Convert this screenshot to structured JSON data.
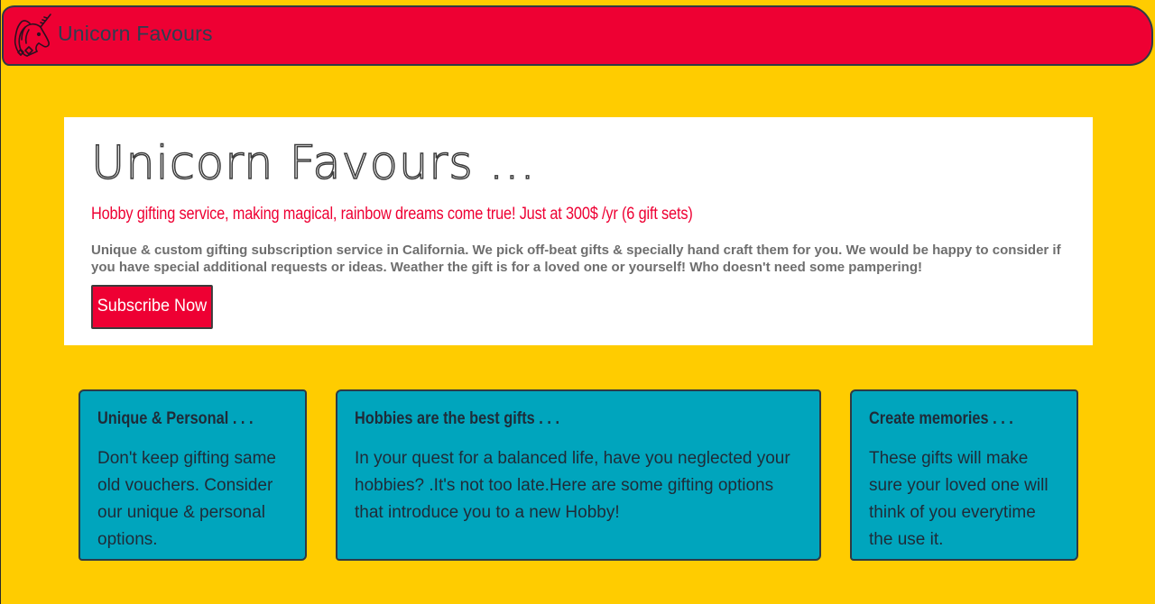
{
  "navbar": {
    "brand_name": "Unicorn Favours",
    "logo_icon": "unicorn-icon"
  },
  "hero": {
    "title": "Unicorn Favours ...",
    "lead": "Hobby gifting service, making magical, rainbow dreams come true! Just at 300$ /yr (6 gift sets)",
    "description": "Unique & custom gifting subscription service in California. We pick off-beat gifts & specially hand craft them for you. We would be happy to consider if you have special additional requests or ideas. Weather the gift is for a loved one or yourself! Who doesn't need some pampering!",
    "cta_label": "Subscribe Now"
  },
  "features": [
    {
      "title": "Unique & Personal . . .",
      "text": "Don't keep gifting same old vouchers. Consider our unique & personal options."
    },
    {
      "title": "Hobbies are the best gifts . . .",
      "text": "In your quest for a balanced life, have you neglected your hobbies? .It's not too late.Here are some gifting options that introduce you to a new Hobby!"
    },
    {
      "title": "Create memories . . .",
      "text": "These gifts will make sure your loved one will think of you everytime the use it."
    }
  ],
  "colors": {
    "page_background": "#ffcc00",
    "brand_red": "#ee0033",
    "card_teal": "#00a5bd",
    "dark_text": "#2d3e50"
  }
}
